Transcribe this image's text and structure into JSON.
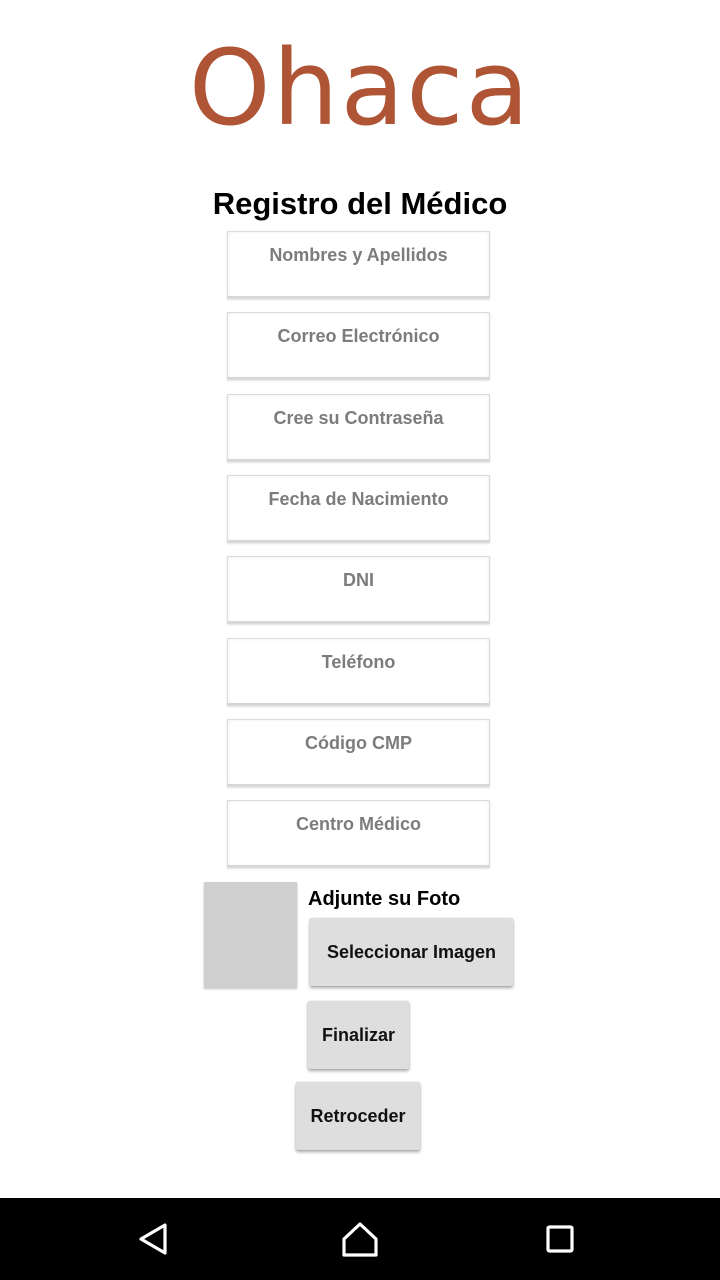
{
  "app": {
    "logo_text": "Ohaca",
    "brand_color": "#b05436"
  },
  "page": {
    "title": "Registro del Médico"
  },
  "form": {
    "fields": [
      {
        "placeholder": "Nombres y Apellidos",
        "value": ""
      },
      {
        "placeholder": "Correo Electrónico",
        "value": ""
      },
      {
        "placeholder": "Cree su Contraseña",
        "value": ""
      },
      {
        "placeholder": "Fecha de Nacimiento",
        "value": ""
      },
      {
        "placeholder": "DNI",
        "value": ""
      },
      {
        "placeholder": "Teléfono",
        "value": ""
      },
      {
        "placeholder": "Código CMP",
        "value": ""
      },
      {
        "placeholder": "Centro Médico",
        "value": ""
      }
    ],
    "photo": {
      "label": "Adjunte su Foto",
      "select_button": "Seleccionar Imagen"
    },
    "finish_button": "Finalizar",
    "back_button": "Retroceder"
  },
  "navbar": {
    "icons": [
      "back-triangle-icon",
      "home-icon",
      "recent-apps-icon"
    ]
  }
}
